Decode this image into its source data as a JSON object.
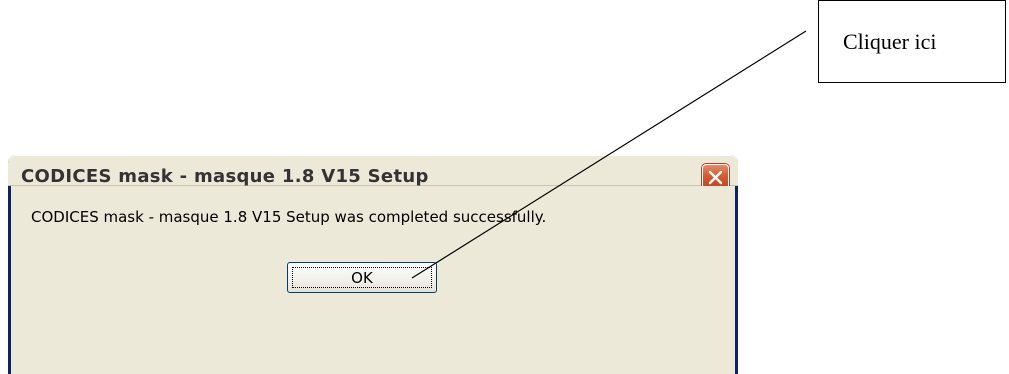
{
  "annotation": {
    "callout_text": "Cliquer ici"
  },
  "dialog": {
    "title": "CODICES mask - masque 1.8 V15 Setup",
    "message": "CODICES mask - masque 1.8 V15 Setup was completed successfully.",
    "ok_label": "OK",
    "close_icon": "close-icon",
    "colors": {
      "frame": "#0a246a",
      "body": "#ece9d8",
      "close_button": "#d35a32"
    }
  }
}
